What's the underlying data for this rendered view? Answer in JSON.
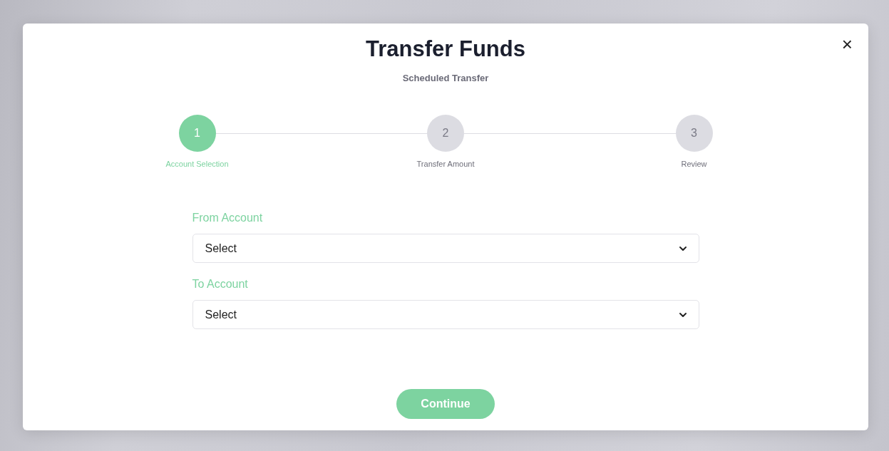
{
  "dialog": {
    "title": "Transfer Funds",
    "subtitle": "Scheduled Transfer",
    "close": "×"
  },
  "steps": [
    {
      "number": "1",
      "label": "Account Selection",
      "selected": true
    },
    {
      "number": "2",
      "label": "Transfer Amount",
      "selected": false
    },
    {
      "number": "3",
      "label": "Review",
      "selected": false
    }
  ],
  "fields": [
    {
      "label": "From Account",
      "value": "Select"
    },
    {
      "label": "To Account",
      "value": "Select"
    }
  ],
  "primary_button": {
    "label": "Continue",
    "disabled": true
  }
}
